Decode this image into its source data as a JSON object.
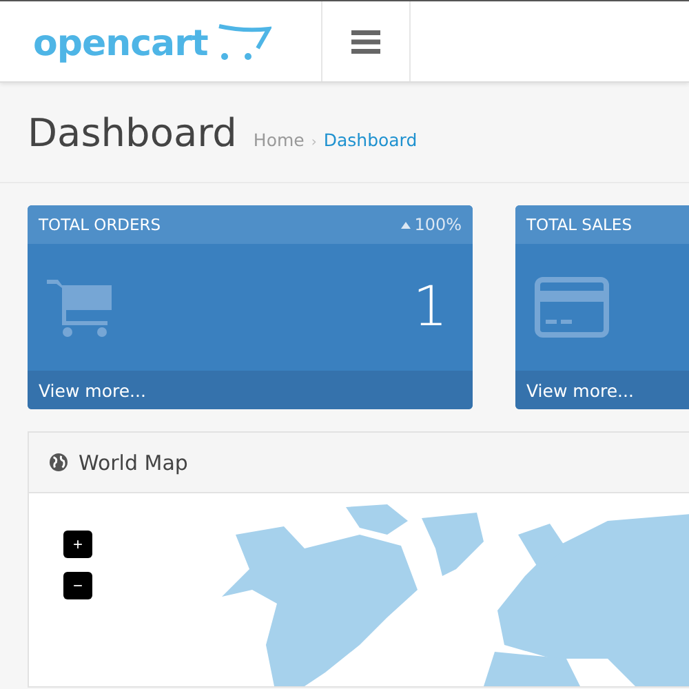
{
  "header": {
    "logo": "opencart"
  },
  "page": {
    "title": "Dashboard",
    "breadcrumb_separator": "›",
    "breadcrumb": [
      {
        "label": "Home",
        "selected": false
      },
      {
        "label": "Dashboard",
        "selected": true
      }
    ]
  },
  "tiles": [
    {
      "kind": "orders",
      "title": "TOTAL ORDERS",
      "change": "100%",
      "value": "1",
      "link": "View more..."
    },
    {
      "kind": "sales",
      "title": "TOTAL SALES",
      "link": "View more..."
    }
  ],
  "map": {
    "title": "World Map",
    "zoom_in": "+",
    "zoom_out": "−"
  }
}
